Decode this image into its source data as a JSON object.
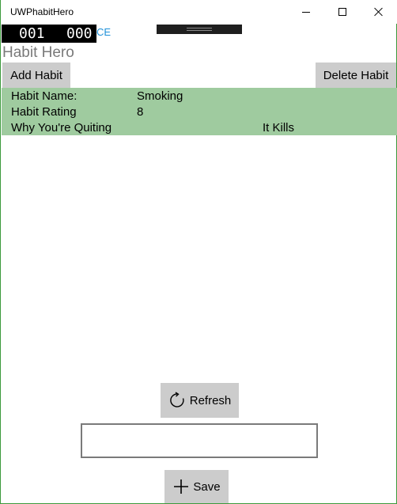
{
  "window": {
    "title": "UWPhabitHero",
    "border_color": "#3c9a3c"
  },
  "debug": {
    "counter_a": "001",
    "counter_b": "000",
    "suffix": "CE"
  },
  "page": {
    "title": "Habit Hero"
  },
  "toolbar": {
    "add_label": "Add Habit",
    "delete_label": "Delete Habit"
  },
  "habit": {
    "name_label": "Habit Name:",
    "name_value": "Smoking",
    "rating_label": "Habit Rating",
    "rating_value": "8",
    "why_label": "Why You're Quiting",
    "why_value": "It Kills",
    "card_color": "#9fcb9f"
  },
  "actions": {
    "refresh_label": "Refresh",
    "refresh_icon": "refresh-icon",
    "input_value": "",
    "save_label": "Save",
    "save_icon": "add-icon"
  }
}
